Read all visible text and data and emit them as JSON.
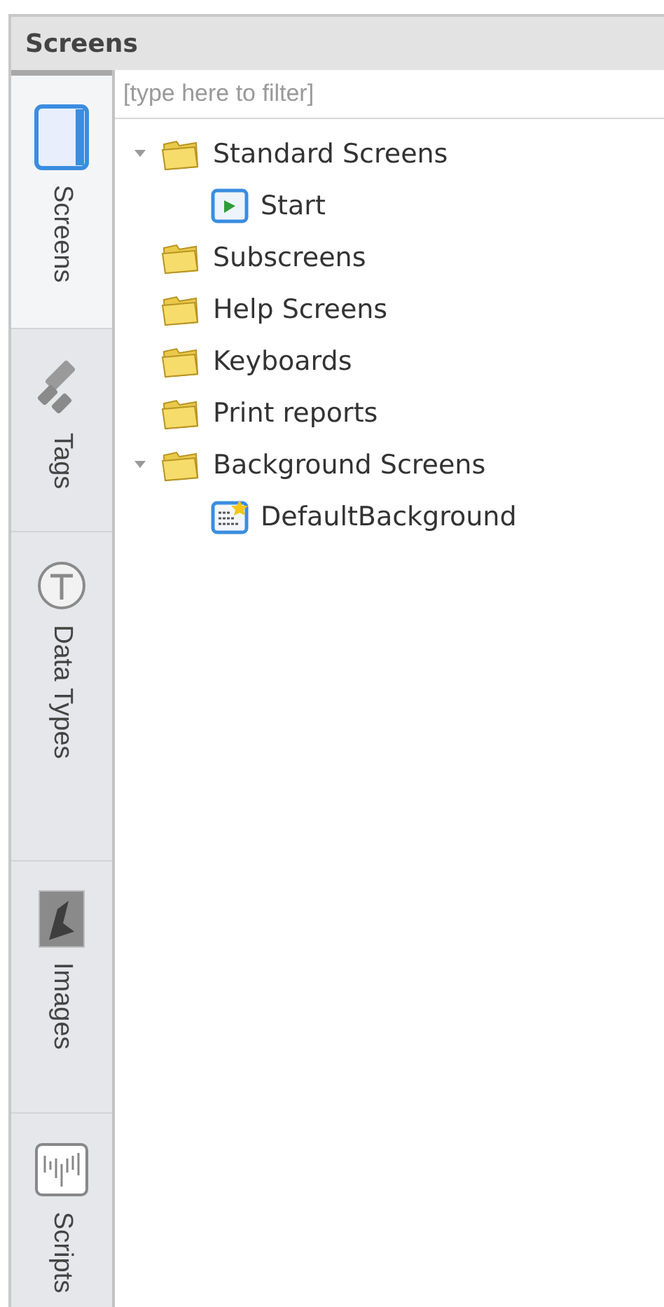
{
  "panel": {
    "title": "Screens"
  },
  "tabs": [
    {
      "label": "Screens",
      "kind": "screens",
      "selected": true
    },
    {
      "label": "Tags",
      "kind": "tags",
      "selected": false
    },
    {
      "label": "Data Types",
      "kind": "types",
      "selected": false
    },
    {
      "label": "Images",
      "kind": "images",
      "selected": false
    },
    {
      "label": "Scripts",
      "kind": "scripts",
      "selected": false
    }
  ],
  "filter": {
    "placeholder": "[type here to filter]"
  },
  "tree": [
    {
      "label": "Standard Screens",
      "kind": "folder",
      "expanded": true,
      "children": [
        {
          "label": "Start",
          "kind": "screen"
        }
      ]
    },
    {
      "label": "Subscreens",
      "kind": "folder"
    },
    {
      "label": "Help Screens",
      "kind": "folder"
    },
    {
      "label": "Keyboards",
      "kind": "folder"
    },
    {
      "label": "Print reports",
      "kind": "folder"
    },
    {
      "label": "Background Screens",
      "kind": "folder",
      "expanded": true,
      "children": [
        {
          "label": "DefaultBackground",
          "kind": "background"
        }
      ]
    }
  ]
}
